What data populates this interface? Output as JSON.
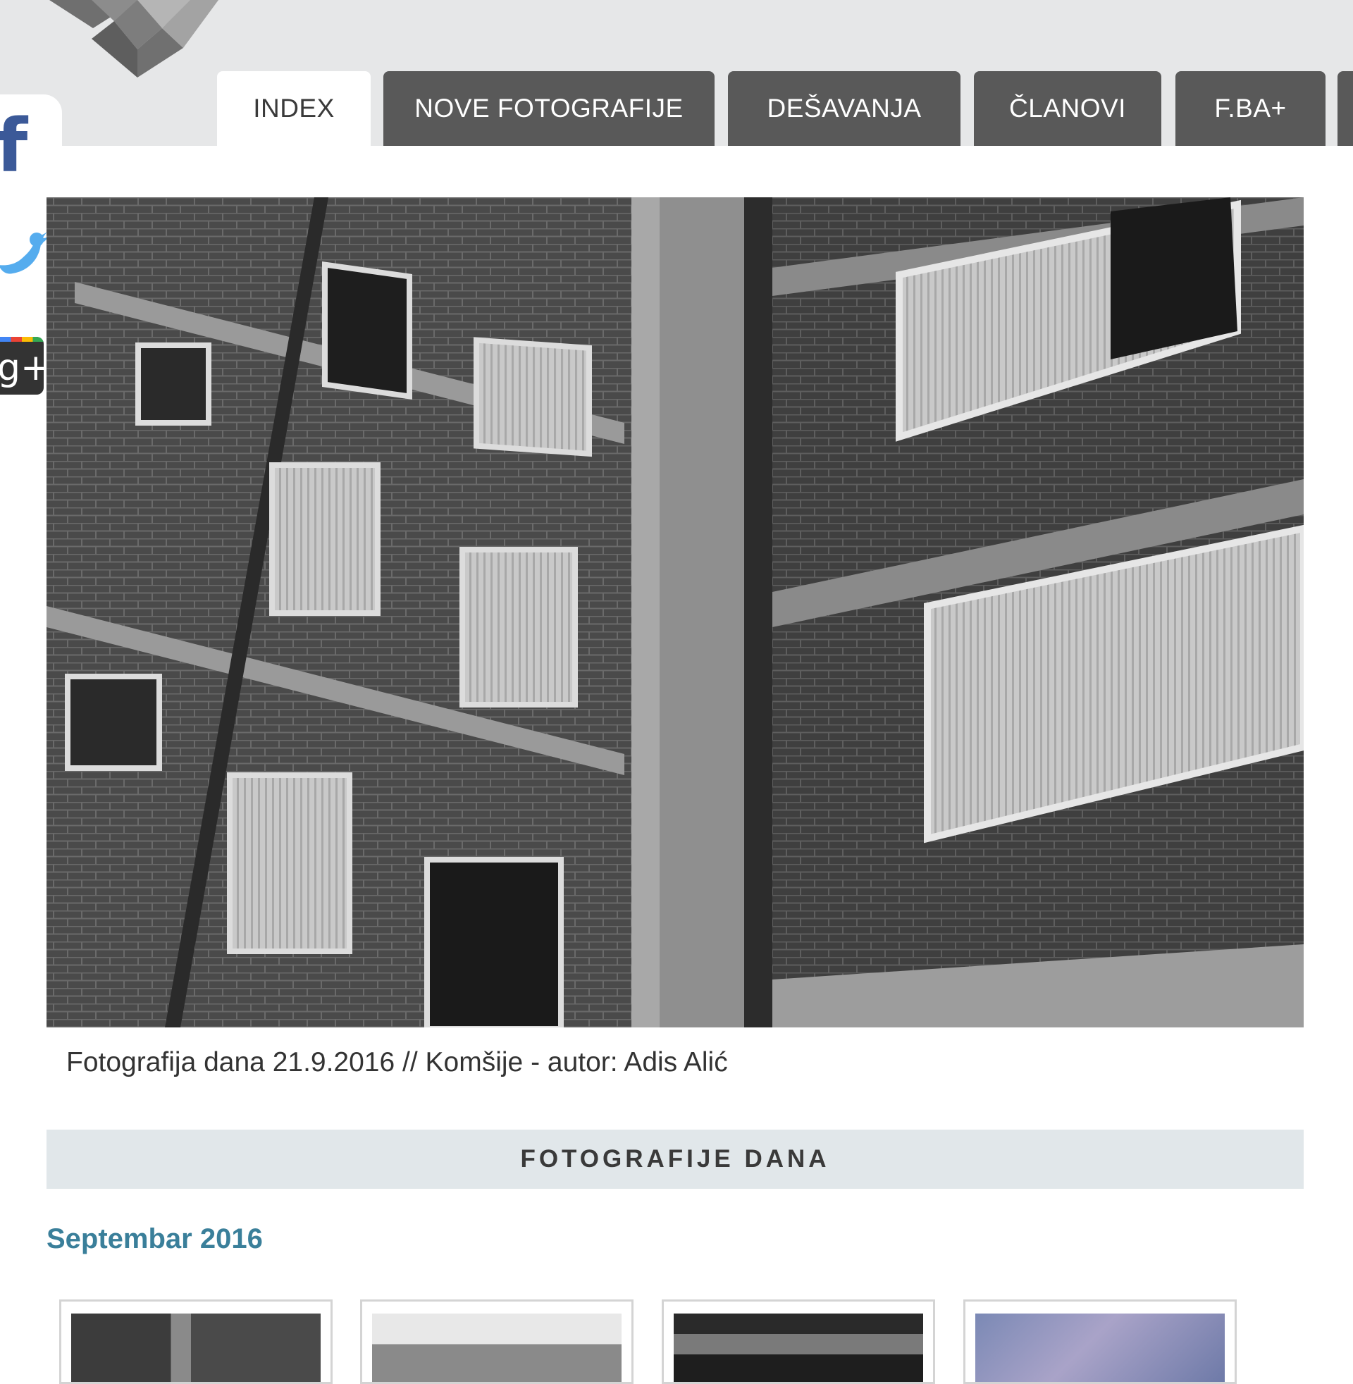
{
  "nav": {
    "tabs": [
      {
        "label": "INDEX",
        "active": true
      },
      {
        "label": "NOVE FOTOGRAFIJE",
        "active": false
      },
      {
        "label": "DEŠAVANJA",
        "active": false
      },
      {
        "label": "ČLANOVI",
        "active": false
      },
      {
        "label": "F.BA+",
        "active": false
      }
    ]
  },
  "social": {
    "facebook_glyph": "f",
    "googleplus_glyph": "g+",
    "icons": [
      "facebook-icon",
      "twitter-icon",
      "google-plus-icon"
    ]
  },
  "photo_of_day": {
    "caption": "Fotografija dana 21.9.2016 // Komšije - autor: Adis Alić"
  },
  "section": {
    "title": "FOTOGRAFIJE DANA",
    "month": "Septembar 2016"
  },
  "colors": {
    "tab_bg": "#595959",
    "header_bg": "#e6e7e8",
    "section_bar_bg": "#e1e7ea",
    "month_text": "#3a7f9a",
    "facebook": "#3b5998",
    "twitter": "#55acee"
  }
}
